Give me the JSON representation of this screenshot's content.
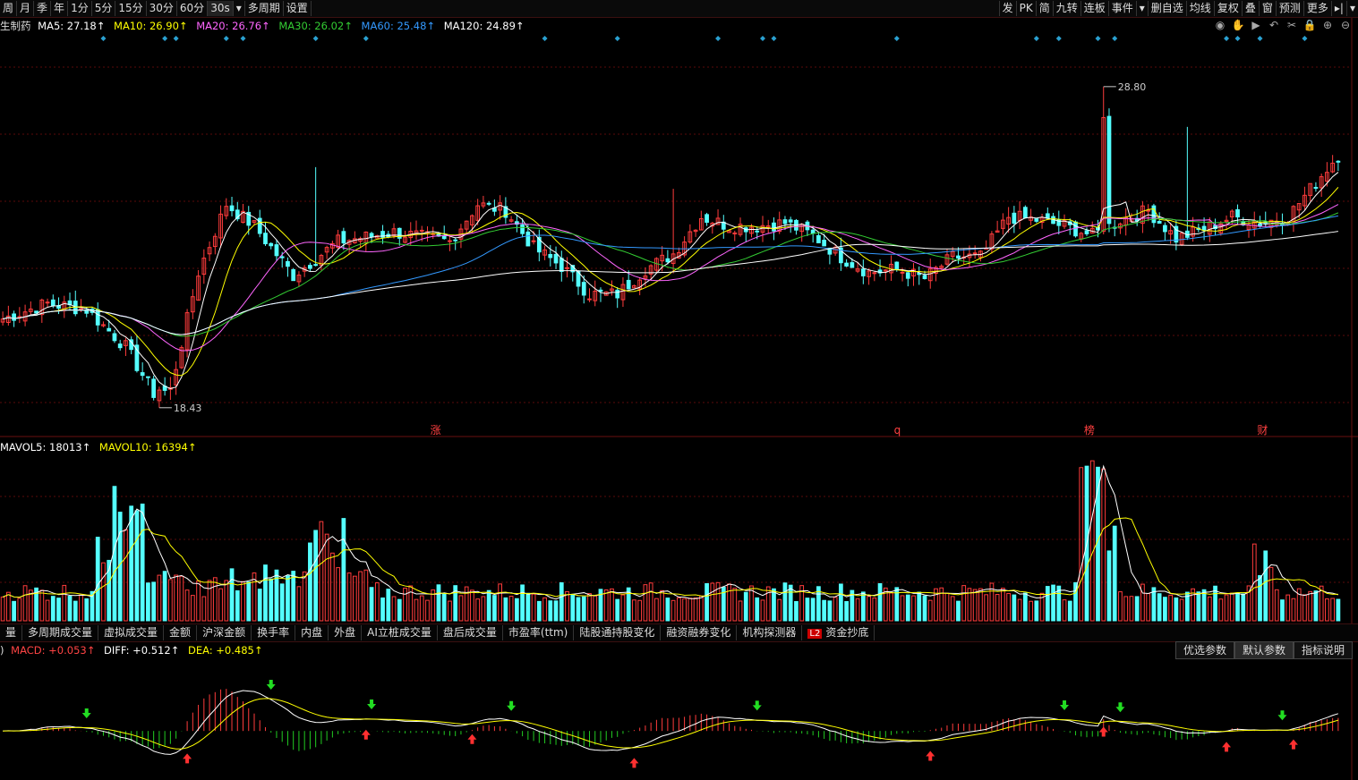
{
  "toolbar": {
    "left": [
      "周",
      "月",
      "季",
      "年",
      "1分",
      "5分",
      "15分",
      "30分",
      "60分",
      "30s",
      "▾",
      "多周期",
      "设置"
    ],
    "right": [
      "发",
      "PK",
      "简",
      "九转",
      "连板",
      "事件",
      "▾",
      "删自选",
      "均线",
      "复权",
      "叠",
      "窗",
      "预测",
      "更多",
      "▸|",
      "▾"
    ]
  },
  "legend": {
    "name": "生制药",
    "ma5": "MA5: 27.18↑",
    "ma10": "MA10: 26.90↑",
    "ma20": "MA20: 26.76↑",
    "ma30": "MA30: 26.02↑",
    "ma60": "MA60: 25.48↑",
    "ma120": "MA120: 24.89↑"
  },
  "volume_legend": {
    "mavol5": "MAVOL5: 18013↑",
    "mavol10": "MAVOL10: 16394↑"
  },
  "tabs": [
    "量",
    "多周期成交量",
    "虚拟成交量",
    "金额",
    "沪深金额",
    "换手率",
    "内盘",
    "外盘",
    "AI立桩成交量",
    "盘后成交量",
    "市盈率(ttm)",
    "陆股通持股变化",
    "融资融券变化",
    "机构探测器",
    "资金抄底"
  ],
  "tab_badge": "L2",
  "macd_legend": {
    "prefix": ")",
    "macd": "MACD: +0.053↑",
    "diff": "DIFF: +0.512↑",
    "dea": "DEA: +0.485↑"
  },
  "param_buttons": [
    "优选参数",
    "默认参数",
    "指标说明"
  ],
  "icons": [
    "eye-icon",
    "hand-icon",
    "play-icon",
    "undo-icon",
    "scissors-icon",
    "lock-icon",
    "zoom-in-icon",
    "zoom-out-icon"
  ],
  "icon_glyphs": [
    "◉",
    "✋",
    "▶",
    "↶",
    "✂",
    "🔒",
    "⊕",
    "⊖"
  ],
  "colors": {
    "up": "#ff3c3c",
    "down": "#54ffff",
    "ma5": "#ffffff",
    "ma10": "#ffff00",
    "ma20": "#ff66ff",
    "ma30": "#33cc33",
    "ma60": "#3399ff",
    "ma120": "#ffffff",
    "grid": "#5a0a0a"
  },
  "chart_data": {
    "type": "candlestick",
    "count": 240,
    "price_range": [
      17.5,
      30.5
    ],
    "high_label": "28.80",
    "low_label": "18.43",
    "high": 28.8,
    "low": 18.43,
    "close_path": [
      [
        0,
        21.3
      ],
      [
        8,
        21.8
      ],
      [
        15,
        21.6
      ],
      [
        22,
        20.4
      ],
      [
        27,
        18.9
      ],
      [
        30,
        19.0
      ],
      [
        35,
        22.8
      ],
      [
        40,
        25.0
      ],
      [
        45,
        24.3
      ],
      [
        52,
        22.7
      ],
      [
        60,
        23.8
      ],
      [
        70,
        24.1
      ],
      [
        80,
        23.8
      ],
      [
        85,
        25.0
      ],
      [
        90,
        24.8
      ],
      [
        95,
        23.6
      ],
      [
        100,
        23.0
      ],
      [
        105,
        22.1
      ],
      [
        110,
        22.1
      ],
      [
        115,
        22.9
      ],
      [
        120,
        23.4
      ],
      [
        125,
        24.6
      ],
      [
        130,
        24.3
      ],
      [
        135,
        24.3
      ],
      [
        140,
        24.4
      ],
      [
        145,
        24.0
      ],
      [
        150,
        23.3
      ],
      [
        155,
        22.8
      ],
      [
        160,
        22.9
      ],
      [
        165,
        22.6
      ],
      [
        170,
        23.3
      ],
      [
        175,
        23.3
      ],
      [
        180,
        24.6
      ],
      [
        185,
        24.5
      ],
      [
        190,
        24.3
      ],
      [
        195,
        24.0
      ],
      [
        200,
        24.5
      ],
      [
        205,
        24.8
      ],
      [
        210,
        23.9
      ],
      [
        215,
        24.2
      ],
      [
        220,
        24.6
      ],
      [
        225,
        24.4
      ],
      [
        230,
        24.6
      ],
      [
        239,
        26.6
      ]
    ],
    "markers": {
      "涨": 77,
      "q": 160,
      "榜": 194,
      "财": 225
    },
    "volume_range": [
      0,
      52000
    ],
    "macd_range": [
      -1.3,
      1.9
    ]
  }
}
